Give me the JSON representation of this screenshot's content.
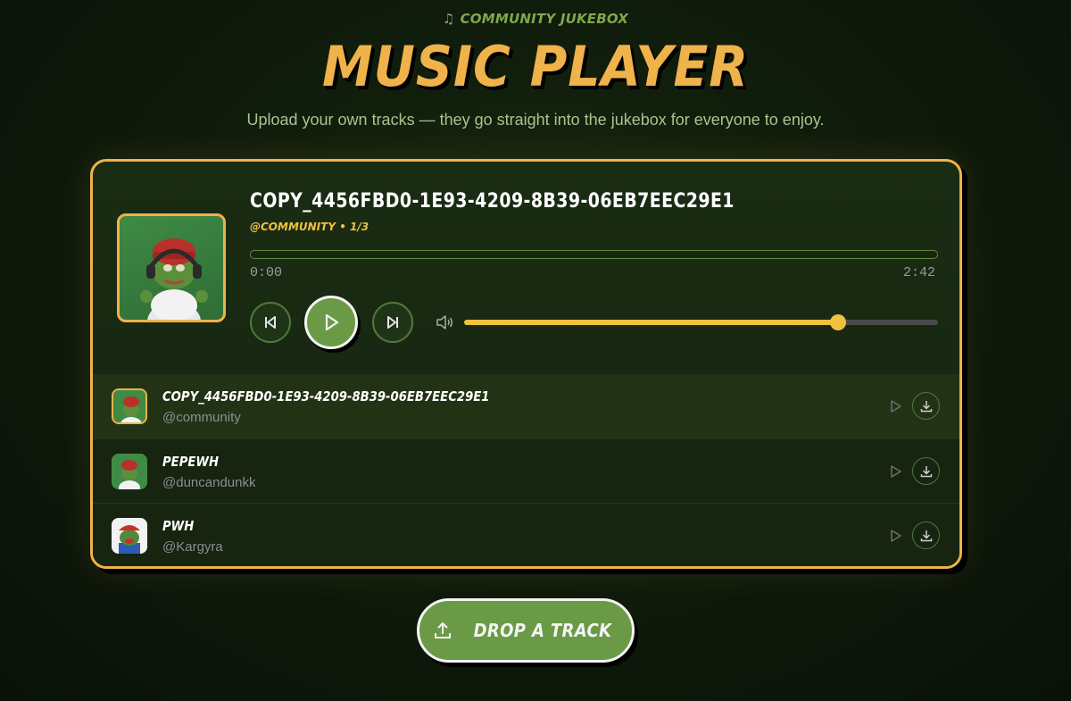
{
  "header": {
    "kicker_icon": "music-note-icon",
    "kicker": "COMMUNITY JUKEBOX",
    "title": "MUSIC PLAYER",
    "subtitle": "Upload your own tracks — they go straight into the jukebox for everyone to enjoy."
  },
  "now_playing": {
    "title": "COPY_4456FBD0-1E93-4209-8B39-06EB7EEC29E1",
    "meta": "@COMMUNITY • 1/3",
    "current_time": "0:00",
    "total_time": "2:42",
    "progress_fraction": 0.0,
    "volume_fraction": 0.79,
    "controls": {
      "prev": "skip-back-icon",
      "play": "play-icon",
      "next": "skip-forward-icon",
      "volume": "volume-icon"
    }
  },
  "tracks": [
    {
      "title": "COPY_4456FBD0-1E93-4209-8B39-06EB7EEC29E1",
      "user": "@community",
      "active": true
    },
    {
      "title": "PEPEWH",
      "user": "@duncandunkk",
      "active": false
    },
    {
      "title": "PWH",
      "user": "@Kargyra",
      "active": false
    }
  ],
  "upload": {
    "label": "DROP A TRACK",
    "icon": "upload-icon"
  },
  "colors": {
    "accent": "#f0b24a",
    "green": "#6a9a45",
    "yellow": "#f0c040"
  }
}
